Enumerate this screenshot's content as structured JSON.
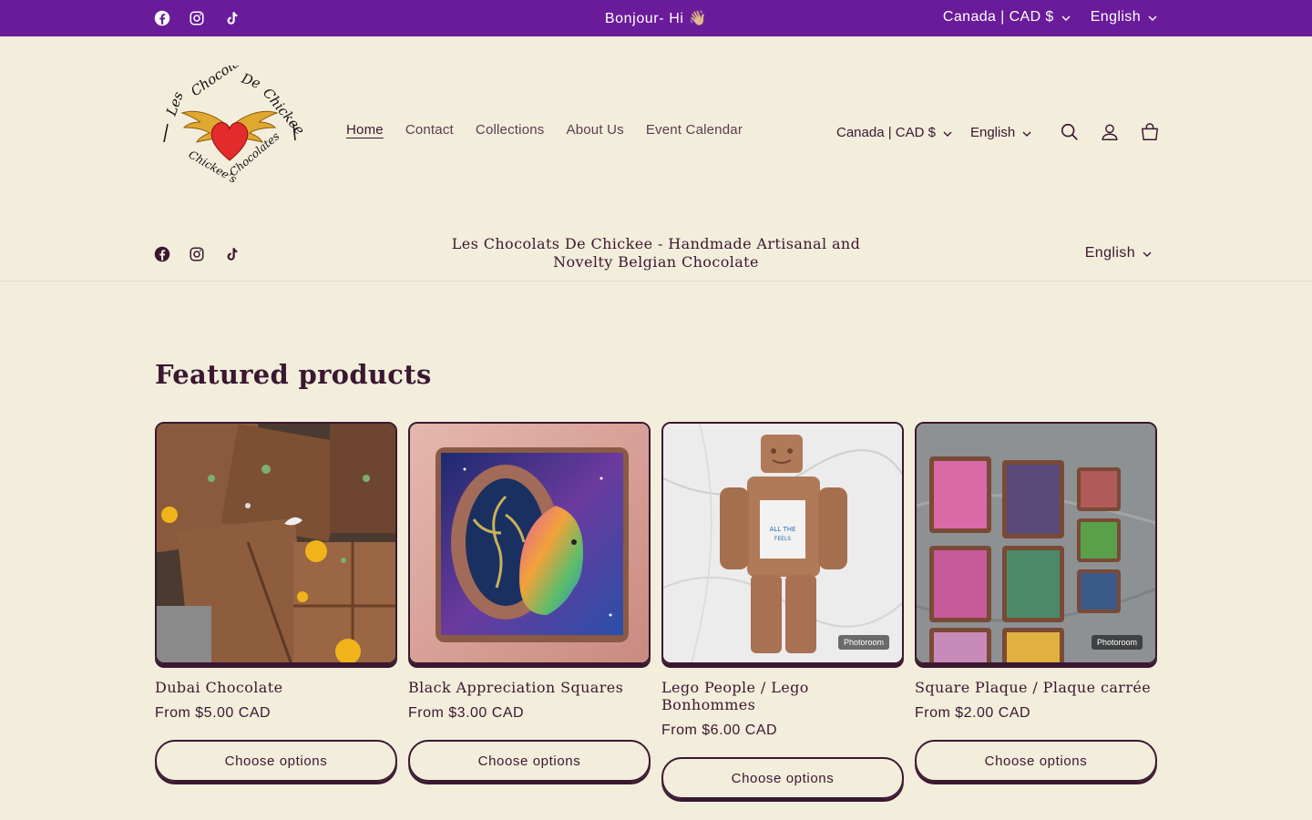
{
  "announcement": {
    "message": "Bonjour- Hi 👋🏼",
    "currency": "Canada | CAD $",
    "language": "English",
    "social_icons": [
      "facebook-icon",
      "instagram-icon",
      "tiktok-icon"
    ]
  },
  "header": {
    "nav": [
      {
        "label": "Home",
        "active": true
      },
      {
        "label": "Contact",
        "active": false
      },
      {
        "label": "Collections",
        "active": false
      },
      {
        "label": "About Us",
        "active": false
      },
      {
        "label": "Event Calendar",
        "active": false
      }
    ],
    "currency": "Canada | CAD $",
    "language": "English",
    "icons": [
      "search-icon",
      "account-icon",
      "cart-icon"
    ]
  },
  "subbar": {
    "tagline": "Les Chocolats De Chickee - Handmade Artisanal and Novelty Belgian Chocolate",
    "language": "English"
  },
  "featured": {
    "title": "Featured products",
    "products": [
      {
        "name": "Dubai Chocolate",
        "price": "From $5.00 CAD",
        "button": "Choose options"
      },
      {
        "name": "Black Appreciation Squares",
        "price": "From $3.00 CAD",
        "button": "Choose options"
      },
      {
        "name": "Lego People / Lego Bonhommes",
        "price": "From $6.00 CAD",
        "button": "Choose options",
        "badge": "Photoroom"
      },
      {
        "name": "Square Plaque / Plaque carrée",
        "price": "From $2.00 CAD",
        "button": "Choose options",
        "badge": "Photoroom"
      }
    ]
  },
  "colors": {
    "announcement_bg": "#6a1b9a",
    "page_bg": "#f3eddc",
    "text": "#3a1830"
  }
}
